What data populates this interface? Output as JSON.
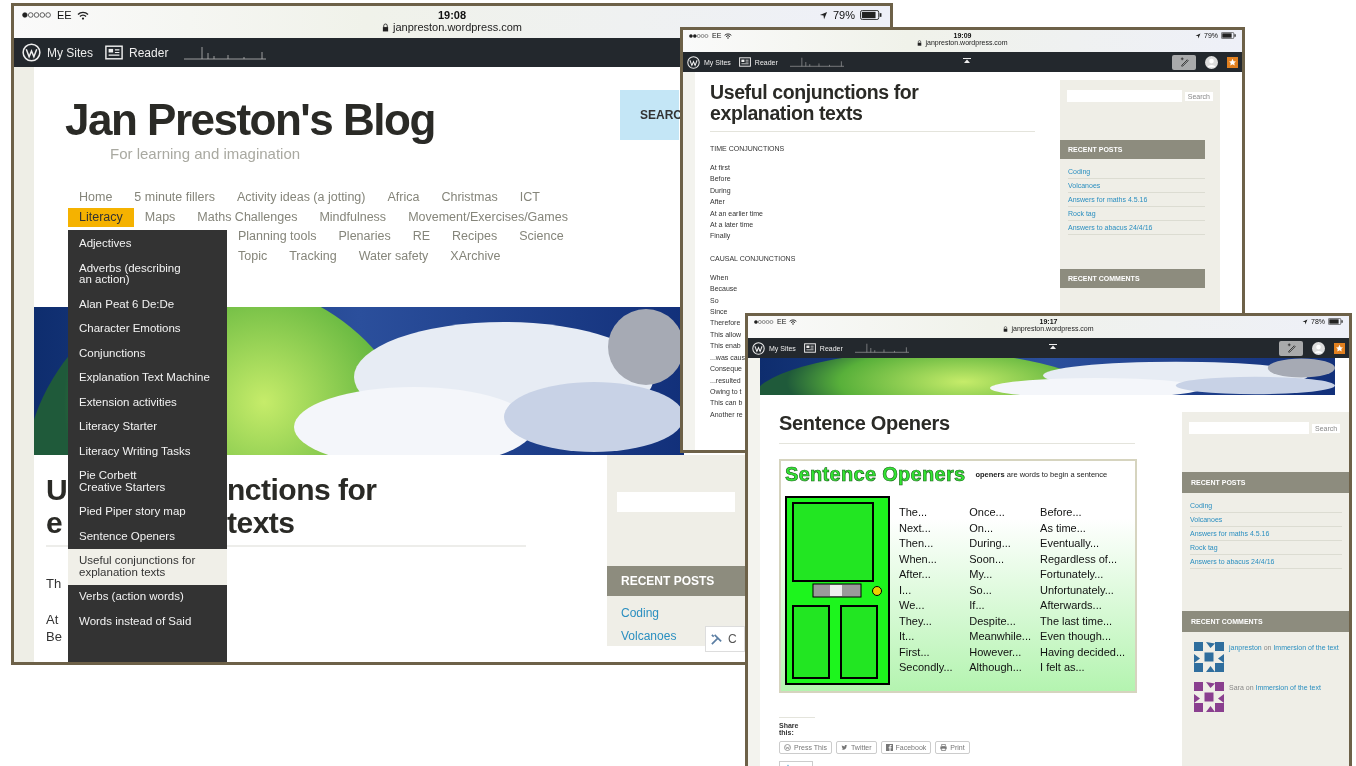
{
  "home_screen": {
    "status_bar": {
      "carrier": "EE",
      "time": "19:08",
      "url": "janpreston.wordpress.com",
      "battery": "79%"
    },
    "admin_bar": {
      "my_sites": "My Sites",
      "reader": "Reader"
    },
    "site_title": "Jan Preston's Blog",
    "tagline": "For learning and imagination",
    "search_label": "SEARC",
    "nav_rows": [
      [
        {
          "label": "Home",
          "selected": false
        },
        {
          "label": "5 minute fillers",
          "selected": false
        },
        {
          "label": "Activity ideas (a jotting)",
          "selected": false
        },
        {
          "label": "Africa",
          "selected": false
        },
        {
          "label": "Christmas",
          "selected": false
        },
        {
          "label": "ICT",
          "selected": false
        }
      ],
      [
        {
          "label": "Literacy",
          "selected": true
        },
        {
          "label": "Maps",
          "selected": false
        },
        {
          "label": "Maths Challenges",
          "selected": false
        },
        {
          "label": "Mindfulness",
          "selected": false
        },
        {
          "label": "Movement/Exercises/Games",
          "selected": false
        }
      ],
      [
        {
          "label": "Planning tools",
          "selected": false
        },
        {
          "label": "Plenaries",
          "selected": false
        },
        {
          "label": "RE",
          "selected": false
        },
        {
          "label": "Recipes",
          "selected": false
        },
        {
          "label": "Science",
          "selected": false
        }
      ],
      [
        {
          "label": "Topic",
          "selected": false
        },
        {
          "label": "Tracking",
          "selected": false
        },
        {
          "label": "Water safety",
          "selected": false
        },
        {
          "label": "XArchive",
          "selected": false
        }
      ]
    ],
    "dropdown": [
      {
        "label": "Adjectives",
        "selected": false
      },
      {
        "label": "Adverbs (describing\nan action)",
        "selected": false
      },
      {
        "label": "Alan Peat 6 De:De",
        "selected": false
      },
      {
        "label": "Character Emotions",
        "selected": false
      },
      {
        "label": "Conjunctions",
        "selected": false
      },
      {
        "label": "Explanation Text Machine",
        "selected": false
      },
      {
        "label": "Extension activities",
        "selected": false
      },
      {
        "label": "Literacy Starter",
        "selected": false
      },
      {
        "label": "Literacy Writing Tasks",
        "selected": false
      },
      {
        "label": "Pie Corbett\nCreative Starters",
        "selected": false
      },
      {
        "label": "Pied Piper story map",
        "selected": false
      },
      {
        "label": "Sentence Openers",
        "selected": false
      },
      {
        "label": "Useful conjunctions for\nexplanation texts",
        "selected": true
      },
      {
        "label": "Verbs (action words)",
        "selected": false
      },
      {
        "label": "Words instead of Said",
        "selected": false
      }
    ],
    "post_title_fragments": [
      [
        "U",
        "nctions for"
      ],
      [
        "e",
        "texts"
      ]
    ],
    "post_text_fragments": [
      "Th",
      "At",
      "Be"
    ],
    "recent_posts_heading": "RECENT POSTS",
    "recent_posts": [
      "Coding",
      "Volcanoes"
    ],
    "customize_button": "C"
  },
  "conjunctions_screen": {
    "status_bar": {
      "carrier": "EE",
      "time": "19:09",
      "url": "janpreston.wordpress.com",
      "battery": "79%"
    },
    "admin_bar": {
      "my_sites": "My Sites",
      "reader": "Reader"
    },
    "post_title": "Useful conjunctions for explanation texts",
    "sections": [
      {
        "heading": "TIME CONJUNCTIONS",
        "items": [
          "At first",
          "Before",
          "During",
          "After",
          "At an earlier time",
          "At a later time",
          "Finally"
        ]
      },
      {
        "heading": "CAUSAL CONJUNCTIONS",
        "items": [
          "When",
          "Because",
          "So",
          "Since",
          "Therefore",
          "This allow",
          "This enab",
          "...was caus",
          "Conseque",
          "...resulted",
          "Owing to t",
          "This can b",
          "Another re"
        ]
      }
    ],
    "search_button": "Search",
    "recent_posts_heading": "RECENT POSTS",
    "recent_posts": [
      "Coding",
      "Volcanoes",
      "Answers for maths 4.5.16",
      "Rock tag",
      "Answers to abacus 24/4/16"
    ],
    "recent_comments_heading": "RECENT COMMENTS"
  },
  "openers_screen": {
    "status_bar": {
      "carrier": "EE",
      "time": "19:17",
      "url": "janpreston.wordpress.com",
      "battery": "78%"
    },
    "admin_bar": {
      "my_sites": "My Sites",
      "reader": "Reader"
    },
    "post_title": "Sentence Openers",
    "poster": {
      "heading": "Sentence Openers",
      "subtitle": "**openers** are words to begin a sentence",
      "columns": [
        [
          "The...",
          "Next...",
          "Then...",
          "When...",
          "After...",
          "I...",
          "We...",
          "They...",
          "It...",
          "First...",
          "Secondly..."
        ],
        [
          "Once...",
          "On...",
          "During...",
          "Soon...",
          "My...",
          "So...",
          "If...",
          "Despite...",
          "Meanwhile...",
          "However...",
          "Although..."
        ],
        [
          "Before...",
          "As time...",
          "Eventually...",
          "Regardless of...",
          "Fortunately...",
          "Unfortunately...",
          "Afterwards...",
          "The last time...",
          "Even though...",
          "Having decided...",
          "I felt as..."
        ]
      ]
    },
    "share_heading": "Share this:",
    "share_buttons": [
      {
        "kind": "press",
        "label": "Press This"
      },
      {
        "kind": "twitter",
        "label": "Twitter"
      },
      {
        "kind": "facebook",
        "label": "Facebook"
      },
      {
        "kind": "print",
        "label": "Print"
      }
    ],
    "search_button": "Search",
    "recent_posts_heading": "RECENT POSTS",
    "recent_posts": [
      "Coding",
      "Volcanoes",
      "Answers for maths 4.5.16",
      "Rock tag",
      "Answers to abacus 24/4/16"
    ],
    "recent_comments_heading": "RECENT COMMENTS",
    "comments": [
      {
        "author": "janpreston",
        "author_linked": true,
        "connector": "on",
        "post": "Immersion of the text",
        "color": "#2f6e9e"
      },
      {
        "author": "Sara",
        "author_linked": false,
        "connector": "on",
        "post": "Immersion of the text",
        "color": "#8a3f8f"
      }
    ]
  }
}
